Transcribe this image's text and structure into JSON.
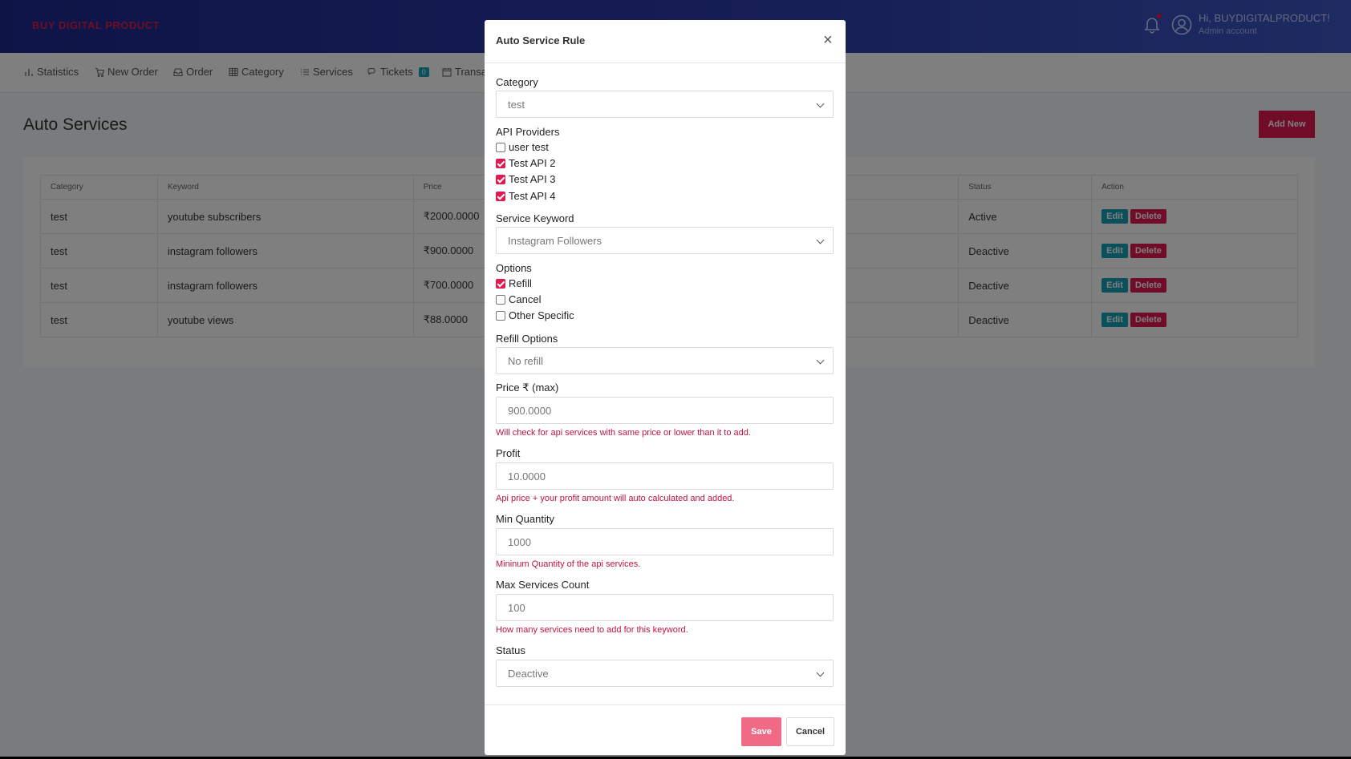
{
  "header": {
    "brand": "BUY DIGITAL PRODUCT",
    "user_name": "Hi, BUYDIGITALPRODUCT!",
    "user_role": "Admin account",
    "notification_icon": "bell-icon",
    "avatar_icon": "user-circle-icon"
  },
  "nav": {
    "items": [
      {
        "label": "Statistics",
        "icon": "bar-chart-icon"
      },
      {
        "label": "New Order",
        "icon": "cart-icon"
      },
      {
        "label": "Order",
        "icon": "inbox-icon"
      },
      {
        "label": "Category",
        "icon": "table-icon"
      },
      {
        "label": "Services",
        "icon": "list-icon"
      },
      {
        "label": "Tickets",
        "icon": "chat-icon",
        "badge": "0"
      },
      {
        "label": "Transa",
        "icon": "calendar-icon"
      }
    ]
  },
  "page": {
    "title": "Auto Services",
    "add_new_label": "Add New"
  },
  "table": {
    "headers": [
      "Category",
      "Keyword",
      "Price",
      "",
      "Status",
      "Action"
    ],
    "rows": [
      {
        "category": "test",
        "keyword": "youtube subscribers",
        "price": "₹2000.0000",
        "status": "Active"
      },
      {
        "category": "test",
        "keyword": "instagram followers",
        "price": "₹900.0000",
        "status": "Deactive"
      },
      {
        "category": "test",
        "keyword": "instagram followers",
        "price": "₹700.0000",
        "status": "Deactive"
      },
      {
        "category": "test",
        "keyword": "youtube views",
        "price": "₹88.0000",
        "status": "Deactive"
      }
    ],
    "edit_label": "Edit",
    "delete_label": "Delete"
  },
  "modal": {
    "title": "Auto Service Rule",
    "close_label": "×",
    "category_label": "Category",
    "category_value": "test",
    "api_providers_label": "API Providers",
    "api_providers": [
      {
        "label": "user test",
        "checked": false
      },
      {
        "label": "Test API 2",
        "checked": true
      },
      {
        "label": "Test API 3",
        "checked": true
      },
      {
        "label": "Test API 4",
        "checked": true
      }
    ],
    "keyword_label": "Service Keyword",
    "keyword_value": "Instagram Followers",
    "options_label": "Options",
    "options": [
      {
        "label": "Refill",
        "checked": true
      },
      {
        "label": "Cancel",
        "checked": false
      },
      {
        "label": "Other Specific",
        "checked": false
      }
    ],
    "refill_label": "Refill Options",
    "refill_value": "No refill",
    "price_label": "Price ₹ (max)",
    "price_value": "900.0000",
    "price_hint": "Will check for api services with same price or lower than it to add.",
    "profit_label": "Profit",
    "profit_value": "10.0000",
    "profit_hint": "Api price + your profit amount will auto calculated and added.",
    "min_qty_label": "Min Quantity",
    "min_qty_value": "1000",
    "min_qty_hint": "Mininum Quantity of the api services.",
    "max_count_label": "Max Services Count",
    "max_count_value": "100",
    "max_count_hint": "How many services need to add for this keyword.",
    "status_label": "Status",
    "status_value": "Deactive",
    "save_label": "Save",
    "cancel_label": "Cancel"
  }
}
